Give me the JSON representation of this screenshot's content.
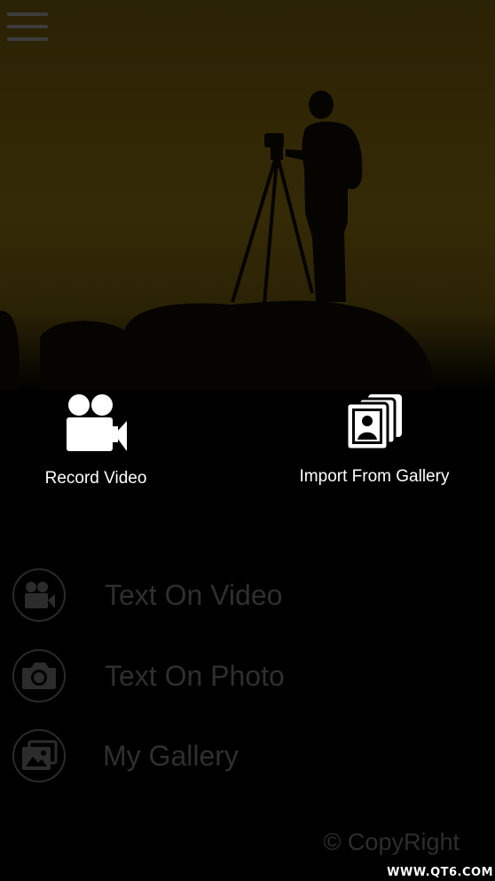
{
  "colors": {
    "sky_top": "#2b2304",
    "sky_mid": "#3a2d06",
    "background": "#000000",
    "icon_white": "#ffffff",
    "dim_text": "#2f2f2f"
  },
  "header": {
    "menu_icon": "hamburger-menu-icon"
  },
  "actions": [
    {
      "label": "Record Video",
      "icon": "video-camera-icon"
    },
    {
      "label": "Import From Gallery",
      "icon": "gallery-import-icon"
    }
  ],
  "menu": [
    {
      "label": "Text On Video",
      "icon": "movie-camera-icon"
    },
    {
      "label": "Text On Photo",
      "icon": "camera-icon"
    },
    {
      "label": "My Gallery",
      "icon": "photo-gallery-icon"
    }
  ],
  "footer": {
    "copyright": "© CopyRight",
    "watermark": "WWW.QT6.COM"
  }
}
